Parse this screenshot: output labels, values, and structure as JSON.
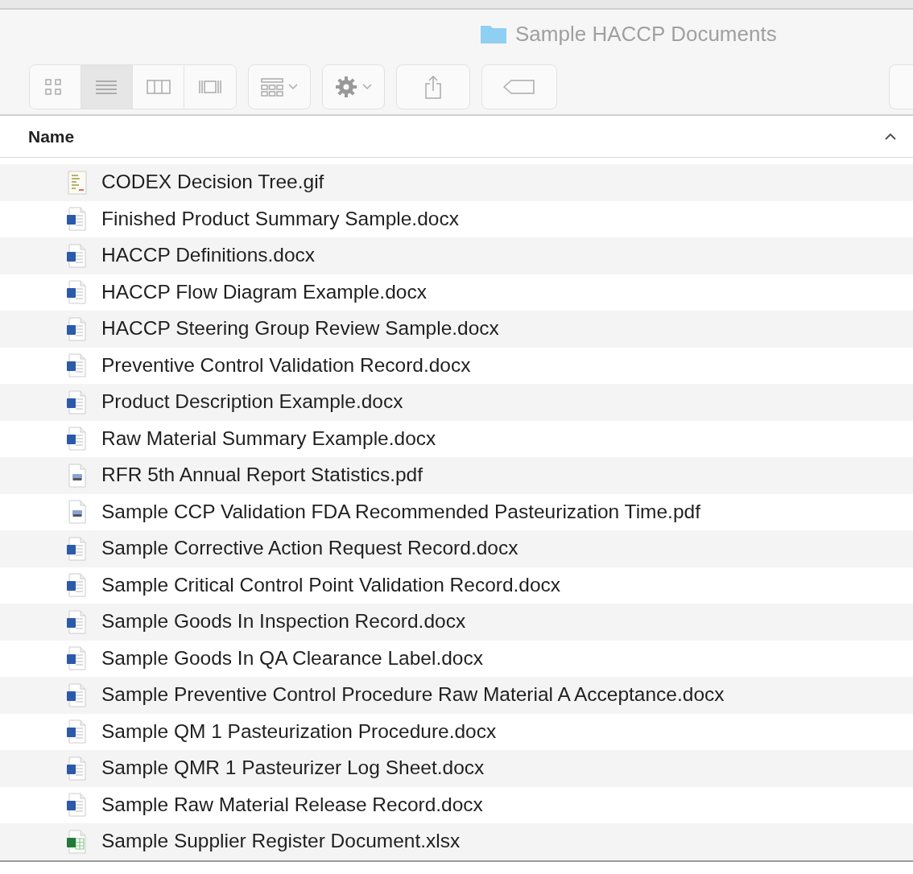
{
  "window": {
    "title": "Sample HACCP Documents"
  },
  "toolbar": {
    "view_modes": [
      {
        "kind": "icons",
        "selected": false
      },
      {
        "kind": "list",
        "selected": true
      },
      {
        "kind": "columns",
        "selected": false
      },
      {
        "kind": "gallery",
        "selected": false
      }
    ]
  },
  "table": {
    "columns": [
      {
        "label": "Name",
        "sort_ascending": true
      }
    ],
    "rows": [
      {
        "name": "CODEX Decision Tree.gif",
        "kind": "image"
      },
      {
        "name": "Finished Product Summary Sample.docx",
        "kind": "word"
      },
      {
        "name": "HACCP Definitions.docx",
        "kind": "word"
      },
      {
        "name": "HACCP Flow Diagram Example.docx",
        "kind": "word"
      },
      {
        "name": "HACCP Steering Group Review Sample.docx",
        "kind": "word"
      },
      {
        "name": "Preventive Control Validation Record.docx",
        "kind": "word"
      },
      {
        "name": "Product Description Example.docx",
        "kind": "word"
      },
      {
        "name": "Raw Material Summary Example.docx",
        "kind": "word"
      },
      {
        "name": "RFR 5th Annual Report Statistics.pdf",
        "kind": "pdf"
      },
      {
        "name": "Sample CCP Validation FDA Recommended Pasteurization Time.pdf",
        "kind": "pdf"
      },
      {
        "name": "Sample Corrective Action Request Record.docx",
        "kind": "word"
      },
      {
        "name": "Sample Critical Control Point Validation Record.docx",
        "kind": "word"
      },
      {
        "name": "Sample Goods In Inspection Record.docx",
        "kind": "word"
      },
      {
        "name": "Sample Goods In QA Clearance Label.docx",
        "kind": "word"
      },
      {
        "name": "Sample Preventive Control Procedure Raw Material A Acceptance.docx",
        "kind": "word"
      },
      {
        "name": "Sample QM 1 Pasteurization Procedure.docx",
        "kind": "word"
      },
      {
        "name": "Sample QMR 1 Pasteurizer Log Sheet.docx",
        "kind": "word"
      },
      {
        "name": "Sample Raw Material Release Record.docx",
        "kind": "word"
      },
      {
        "name": "Sample Supplier Register Document.xlsx",
        "kind": "excel"
      }
    ]
  }
}
